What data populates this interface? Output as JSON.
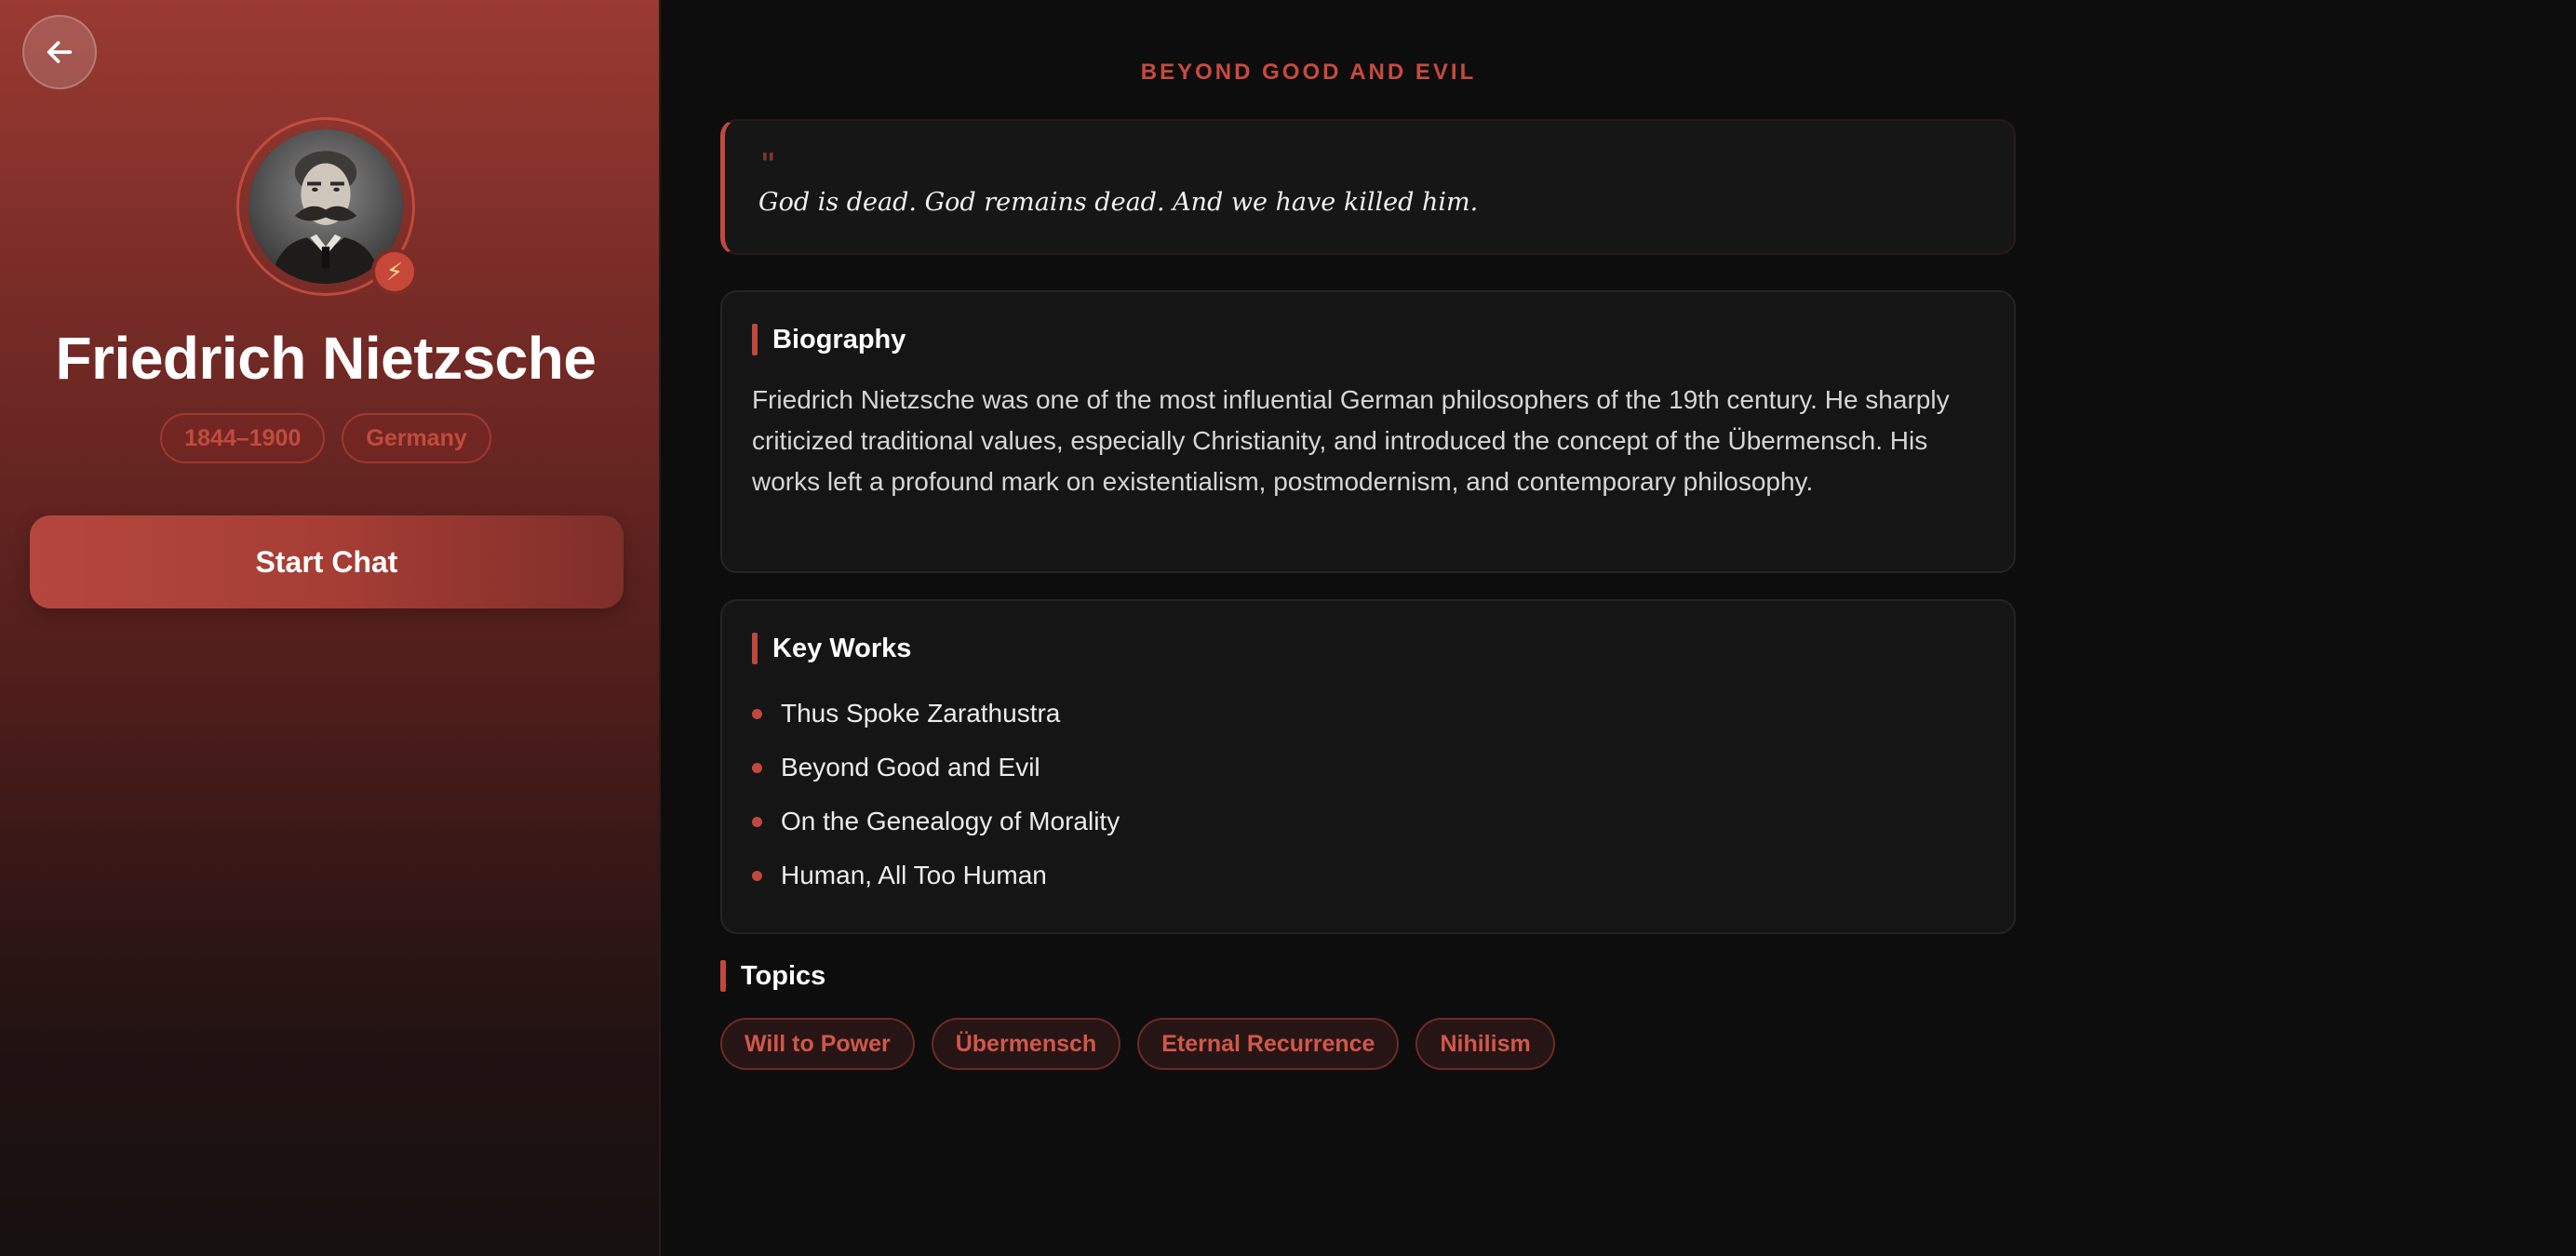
{
  "philosopher": {
    "name": "Friedrich Nietzsche",
    "years": "1844–1900",
    "country": "Germany",
    "start_chat_label": "Start Chat"
  },
  "icons": {
    "back": "arrow-left-icon",
    "badge": "lightning-bolt-icon",
    "badge_glyph": "⚡"
  },
  "quote": {
    "source": "BEYOND GOOD AND EVIL",
    "mark": "\"",
    "text": "God is dead. God remains dead. And we have killed him."
  },
  "biography": {
    "title": "Biography",
    "text": "Friedrich Nietzsche was one of the most influential German philosophers of the 19th century. He sharply criticized traditional values, especially Christianity, and introduced the concept of the Übermensch. His works left a profound mark on existentialism, postmodernism, and contemporary philosophy."
  },
  "key_works": {
    "title": "Key Works",
    "items": [
      "Thus Spoke Zarathustra",
      "Beyond Good and Evil",
      "On the Genealogy of Morality",
      "Human, All Too Human"
    ]
  },
  "topics": {
    "title": "Topics",
    "items": [
      "Will to Power",
      "Übermensch",
      "Eternal Recurrence",
      "Nihilism"
    ]
  },
  "colors": {
    "accent": "#c0483c",
    "background": "#0d0d0d",
    "card": "#151515"
  }
}
